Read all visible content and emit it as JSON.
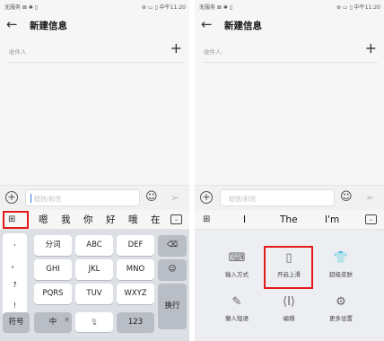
{
  "left": {
    "status": {
      "left": "无服务 ⊠ ✱ ▯",
      "right": "⊛ ▭ ▯ 中午11:20"
    },
    "title": "新建信息",
    "recipient_label": "收件人",
    "input_placeholder": "短信/彩信",
    "candidates": [
      "嗯",
      "我",
      "你",
      "好",
      "哦",
      "在"
    ],
    "punctuation": [
      ",",
      "。",
      "?",
      "!"
    ],
    "keys_row1": [
      "分词",
      "ABC",
      "DEF"
    ],
    "keys_row2": [
      "GHI",
      "JKL",
      "MNO"
    ],
    "keys_row3": [
      "PQRS",
      "TUV",
      "WXYZ"
    ],
    "bottom": {
      "symbol": "符号",
      "lang": "中",
      "lang_sub": "英",
      "num": "123",
      "enter": "换行"
    }
  },
  "right": {
    "status": {
      "left": "无服务 ⊠ ✱ ▯",
      "right": "⊛ ▭ ▯ 中午11:20"
    },
    "title": "新建信息",
    "recipient_label": "收件人:",
    "input_placeholder": "短信/彩信",
    "candidates": [
      "I",
      "The",
      "I'm"
    ],
    "tools": [
      {
        "label": "输入方式",
        "icon": "keyboard-icon"
      },
      {
        "label": "开启上滑",
        "icon": "swipe-up-icon"
      },
      {
        "label": "超级皮肤",
        "icon": "shirt-icon"
      },
      {
        "label": "懒人短语",
        "icon": "quick-phrase-icon"
      },
      {
        "label": "编辑",
        "icon": "cursor-edit-icon"
      },
      {
        "label": "更多设置",
        "icon": "settings-icon"
      }
    ]
  },
  "colors": {
    "highlight": "#e21a1a",
    "caret": "#2a7ae4"
  }
}
